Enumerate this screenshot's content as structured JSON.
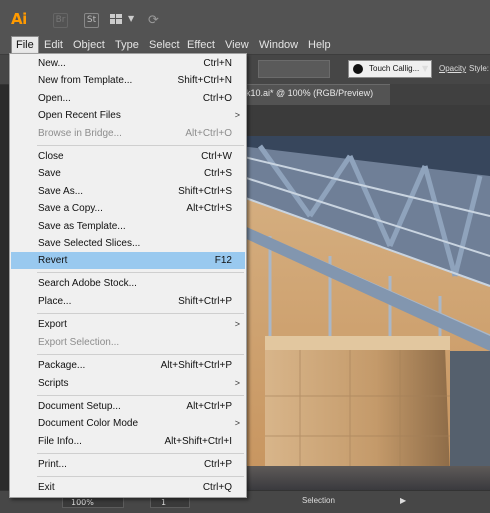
{
  "app": {
    "logo": "Ai",
    "bridge_icon": "Br",
    "stock_icon": "St"
  },
  "menubar": [
    "File",
    "Edit",
    "Object",
    "Type",
    "Select",
    "Effect",
    "View",
    "Window",
    "Help"
  ],
  "control_bar": {
    "brush": "Touch Callig...",
    "opacity_label": "Opacity",
    "style_label": "Style:"
  },
  "document_tab": {
    "title": "k10.ai* @ 100% (RGB/Preview)"
  },
  "file_menu": {
    "items": [
      {
        "label": "New...",
        "shortcut": "Ctrl+N",
        "submenu": false,
        "disabled": false
      },
      {
        "label": "New from Template...",
        "shortcut": "Shift+Ctrl+N",
        "submenu": false,
        "disabled": false
      },
      {
        "label": "Open...",
        "shortcut": "Ctrl+O",
        "submenu": false,
        "disabled": false
      },
      {
        "label": "Open Recent Files",
        "shortcut": "",
        "submenu": true,
        "disabled": false
      },
      {
        "label": "Browse in Bridge...",
        "shortcut": "Alt+Ctrl+O",
        "submenu": false,
        "disabled": true
      },
      {
        "label": "Close",
        "shortcut": "Ctrl+W",
        "submenu": false,
        "disabled": false
      },
      {
        "label": "Save",
        "shortcut": "Ctrl+S",
        "submenu": false,
        "disabled": false
      },
      {
        "label": "Save As...",
        "shortcut": "Shift+Ctrl+S",
        "submenu": false,
        "disabled": false
      },
      {
        "label": "Save a Copy...",
        "shortcut": "Alt+Ctrl+S",
        "submenu": false,
        "disabled": false
      },
      {
        "label": "Save as Template...",
        "shortcut": "",
        "submenu": false,
        "disabled": false
      },
      {
        "label": "Save Selected Slices...",
        "shortcut": "",
        "submenu": false,
        "disabled": false
      },
      {
        "label": "Revert",
        "shortcut": "F12",
        "submenu": false,
        "disabled": false,
        "highlighted": true
      },
      {
        "label": "Search Adobe Stock...",
        "shortcut": "",
        "submenu": false,
        "disabled": false
      },
      {
        "label": "Place...",
        "shortcut": "Shift+Ctrl+P",
        "submenu": false,
        "disabled": false
      },
      {
        "label": "Export",
        "shortcut": "",
        "submenu": true,
        "disabled": false
      },
      {
        "label": "Export Selection...",
        "shortcut": "",
        "submenu": false,
        "disabled": true
      },
      {
        "label": "Package...",
        "shortcut": "Alt+Shift+Ctrl+P",
        "submenu": false,
        "disabled": false
      },
      {
        "label": "Scripts",
        "shortcut": "",
        "submenu": true,
        "disabled": false
      },
      {
        "label": "Document Setup...",
        "shortcut": "Alt+Ctrl+P",
        "submenu": false,
        "disabled": false
      },
      {
        "label": "Document Color Mode",
        "shortcut": "",
        "submenu": true,
        "disabled": false
      },
      {
        "label": "File Info...",
        "shortcut": "Alt+Shift+Ctrl+I",
        "submenu": false,
        "disabled": false
      },
      {
        "label": "Print...",
        "shortcut": "Ctrl+P",
        "submenu": false,
        "disabled": false
      },
      {
        "label": "Exit",
        "shortcut": "Ctrl+Q",
        "submenu": false,
        "disabled": false
      }
    ]
  },
  "status_bar": {
    "zoom": "100%",
    "artboard": "1",
    "tool": "Selection"
  },
  "colors": {
    "menu_bg": "#f0f0f0",
    "highlight": "#99c9ef",
    "app_bg": "#535353",
    "logo_orange": "#ff9a00"
  }
}
